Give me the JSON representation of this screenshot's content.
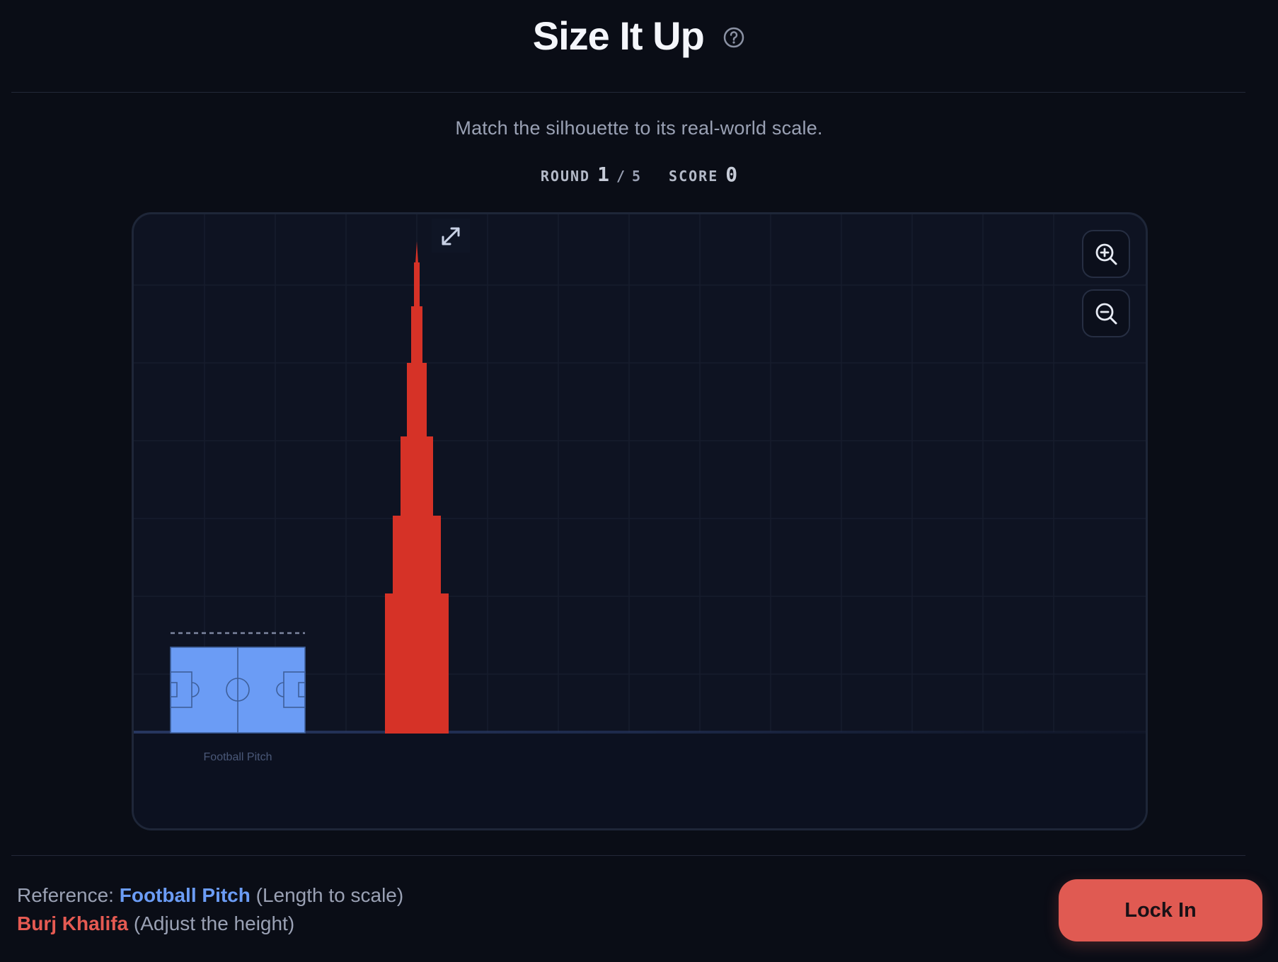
{
  "header": {
    "title": "Size It Up",
    "help_icon": "question-circle-icon"
  },
  "subtitle": "Match the silhouette to its real-world scale.",
  "stats": {
    "round_label": "ROUND",
    "round_current": "1",
    "round_separator": "/",
    "round_total": "5",
    "score_label": "SCORE",
    "score_value": "0"
  },
  "stage": {
    "reference_label": "Football Pitch",
    "reference_color": "#6b9cf5",
    "target_color": "#d63227",
    "resize_icon": "diagonal-resize-icon",
    "zoom_in_icon": "zoom-in-icon",
    "zoom_out_icon": "zoom-out-icon"
  },
  "footer": {
    "reference_prefix": "Reference:",
    "reference_name": "Football Pitch",
    "reference_hint": "(Length to scale)",
    "target_name": "Burj Khalifa",
    "target_hint": "(Adjust the height)",
    "lock_label": "Lock In"
  },
  "colors": {
    "background": "#0a0d16",
    "accent": "#e05a52",
    "reference": "#6b9cf5"
  }
}
